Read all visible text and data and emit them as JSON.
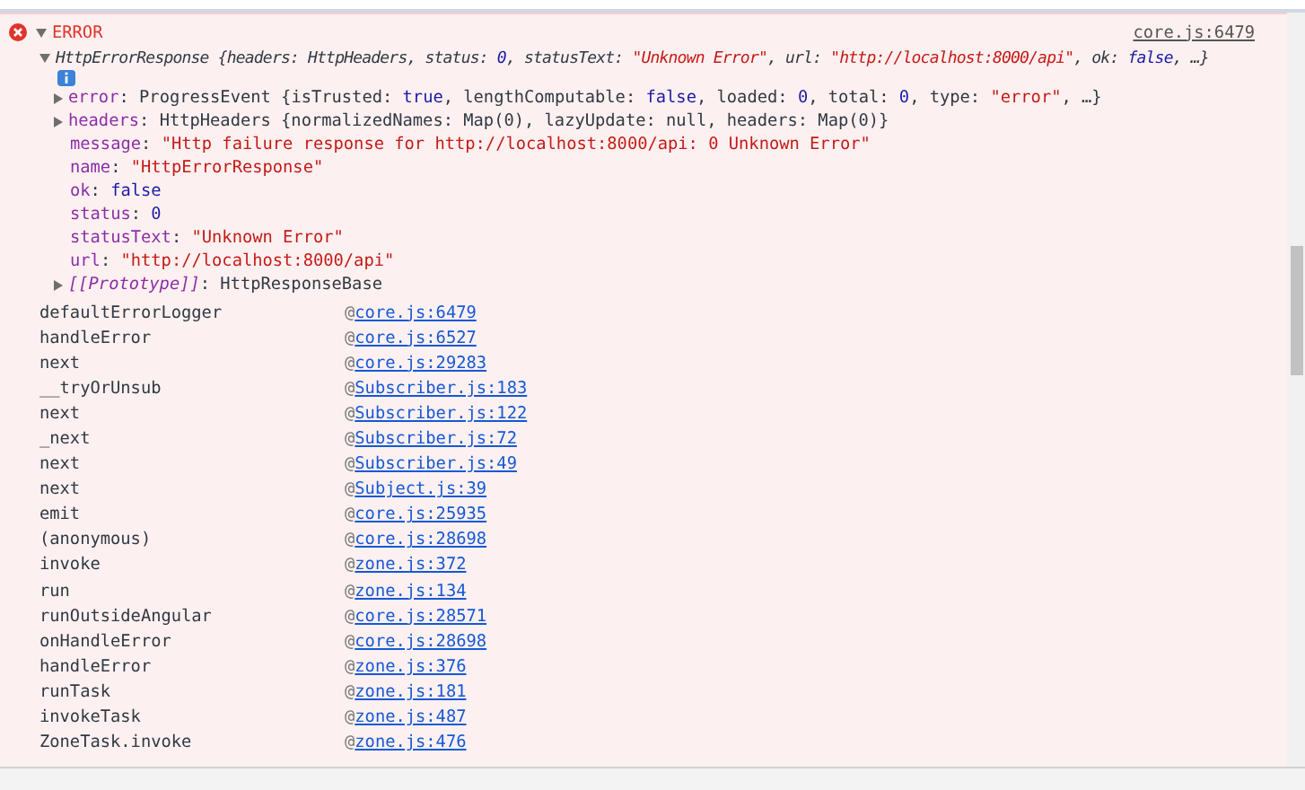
{
  "message": {
    "label": "ERROR",
    "expanded": true,
    "source": "core.js:6479"
  },
  "summary": {
    "expanded": true,
    "segments": [
      {
        "kind": "plain",
        "text": "HttpErrorResponse {headers: HttpHeaders, status: "
      },
      {
        "kind": "number",
        "text": "0"
      },
      {
        "kind": "plain",
        "text": ", statusText: "
      },
      {
        "kind": "string",
        "text": "\"Unknown Error\""
      },
      {
        "kind": "plain",
        "text": ", url: "
      },
      {
        "kind": "string",
        "text": "\"http://localhost:8000/api\""
      },
      {
        "kind": "plain",
        "text": ", ok: "
      },
      {
        "kind": "number",
        "text": "false"
      },
      {
        "kind": "plain",
        "text": ", …}"
      }
    ]
  },
  "properties": [
    {
      "key": "error",
      "separator": ": ",
      "expanded": false,
      "internal": false,
      "segments": [
        {
          "kind": "plain",
          "text": "ProgressEvent {isTrusted: "
        },
        {
          "kind": "number",
          "text": "true"
        },
        {
          "kind": "plain",
          "text": ", lengthComputable: "
        },
        {
          "kind": "number",
          "text": "false"
        },
        {
          "kind": "plain",
          "text": ", loaded: "
        },
        {
          "kind": "number",
          "text": "0"
        },
        {
          "kind": "plain",
          "text": ", total: "
        },
        {
          "kind": "number",
          "text": "0"
        },
        {
          "kind": "plain",
          "text": ", type: "
        },
        {
          "kind": "string",
          "text": "\"error\""
        },
        {
          "kind": "plain",
          "text": ", …}"
        }
      ]
    },
    {
      "key": "headers",
      "separator": ": ",
      "expanded": false,
      "internal": false,
      "segments": [
        {
          "kind": "plain",
          "text": "HttpHeaders {normalizedNames: Map(0), lazyUpdate: null, headers: Map(0)}"
        }
      ]
    },
    {
      "key": "message",
      "separator": ": ",
      "internal": false,
      "segments": [
        {
          "kind": "string",
          "text": "\"Http failure response for http://localhost:8000/api: 0 Unknown Error\""
        }
      ]
    },
    {
      "key": "name",
      "separator": ": ",
      "internal": false,
      "segments": [
        {
          "kind": "string",
          "text": "\"HttpErrorResponse\""
        }
      ]
    },
    {
      "key": "ok",
      "separator": ": ",
      "internal": false,
      "segments": [
        {
          "kind": "number",
          "text": "false"
        }
      ]
    },
    {
      "key": "status",
      "separator": ": ",
      "internal": false,
      "segments": [
        {
          "kind": "number",
          "text": "0"
        }
      ]
    },
    {
      "key": "statusText",
      "separator": ": ",
      "internal": false,
      "segments": [
        {
          "kind": "string",
          "text": "\"Unknown Error\""
        }
      ]
    },
    {
      "key": "url",
      "separator": ": ",
      "internal": false,
      "segments": [
        {
          "kind": "string",
          "text": "\"http://localhost:8000/api\""
        }
      ]
    },
    {
      "key": "[[Prototype]]",
      "separator": ": ",
      "expanded": false,
      "internal": true,
      "segments": [
        {
          "kind": "plain",
          "text": "HttpResponseBase"
        }
      ]
    }
  ],
  "stack": [
    {
      "function": "defaultErrorLogger",
      "at": "@",
      "location": "core.js:6479"
    },
    {
      "function": "handleError",
      "at": "@",
      "location": "core.js:6527"
    },
    {
      "function": "next",
      "at": "@",
      "location": "core.js:29283"
    },
    {
      "function": "__tryOrUnsub",
      "at": "@",
      "location": "Subscriber.js:183"
    },
    {
      "function": "next",
      "at": "@",
      "location": "Subscriber.js:122"
    },
    {
      "function": "_next",
      "at": "@",
      "location": "Subscriber.js:72"
    },
    {
      "function": "next",
      "at": "@",
      "location": "Subscriber.js:49"
    },
    {
      "function": "next",
      "at": "@",
      "location": "Subject.js:39"
    },
    {
      "function": "emit",
      "at": "@",
      "location": "core.js:25935"
    },
    {
      "function": "(anonymous)",
      "at": "@",
      "location": "core.js:28698"
    },
    {
      "function": "invoke",
      "at": "@",
      "location": "zone.js:372"
    },
    {
      "function": "run",
      "at": "@",
      "location": "zone.js:134"
    },
    {
      "function": "runOutsideAngular",
      "at": "@",
      "location": "core.js:28571"
    },
    {
      "function": "onHandleError",
      "at": "@",
      "location": "core.js:28698"
    },
    {
      "function": "handleError",
      "at": "@",
      "location": "zone.js:376"
    },
    {
      "function": "runTask",
      "at": "@",
      "location": "zone.js:181"
    },
    {
      "function": "invokeTask",
      "at": "@",
      "location": "zone.js:487"
    },
    {
      "function": "ZoneTask.invoke",
      "at": "@",
      "location": "zone.js:476"
    }
  ]
}
